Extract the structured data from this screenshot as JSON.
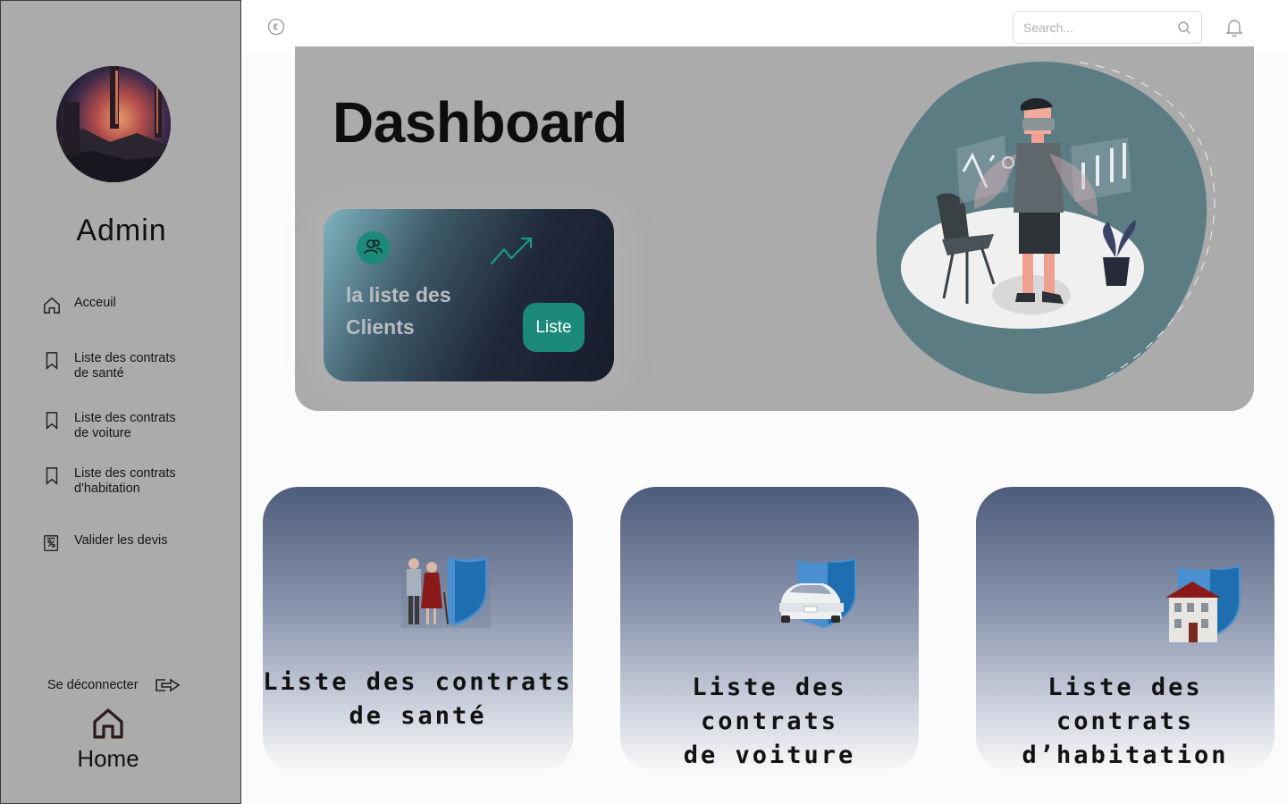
{
  "sidebar": {
    "admin_name": "Admin",
    "nav": [
      {
        "label": "Acceuil",
        "icon": "home-icon"
      },
      {
        "label": "Liste des contrats\nde santé",
        "icon": "bookmark-icon"
      },
      {
        "label": "Liste des contrats\nde voiture",
        "icon": "bookmark-icon"
      },
      {
        "label": "Liste des contrats\nd'habitation",
        "icon": "bookmark-icon"
      },
      {
        "label": "Valider les devis",
        "icon": "percent-receipt-icon"
      }
    ],
    "logout_label": "Se déconnecter",
    "home_label": "Home"
  },
  "topbar": {
    "search_placeholder": "Search..."
  },
  "hero": {
    "title": "Dashboard",
    "client_card": {
      "title": "la liste des Clients",
      "button_label": "Liste"
    }
  },
  "cards": [
    {
      "label": "Liste des contrats\nde santé",
      "icon": "elderly-couple-shield-icon"
    },
    {
      "label": "Liste des contrats\nde voiture",
      "icon": "car-shield-icon"
    },
    {
      "label": "Liste des contrats\nd’habitation",
      "icon": "house-shield-icon"
    }
  ],
  "colors": {
    "sidebar_bg": "#ababab",
    "accent_teal": "#1b8a7a",
    "card_top": "#4e5c7c"
  }
}
